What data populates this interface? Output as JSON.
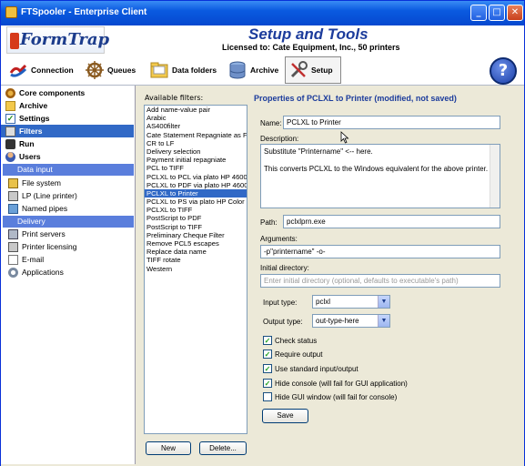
{
  "window": {
    "title": "FTSpooler - Enterprise Client"
  },
  "header": {
    "logo_text": "FormTrap",
    "title": "Setup and Tools",
    "licensed": "Licensed to: Cate Equipment, Inc., 50 printers"
  },
  "toolbar": {
    "connection": "Connection",
    "queues": "Queues",
    "data_folders": "Data folders",
    "archive": "Archive",
    "setup": "Setup",
    "help": "?"
  },
  "sidebar": {
    "core_components": "Core components",
    "archive": "Archive",
    "settings": "Settings",
    "filters": "Filters",
    "run": "Run",
    "users": "Users",
    "data_input": "Data input",
    "file_system": "File system",
    "lp": "LP (Line printer)",
    "named_pipes": "Named pipes",
    "delivery": "Delivery",
    "print_servers": "Print servers",
    "printer_licensing": "Printer licensing",
    "email": "E-mail",
    "applications": "Applications"
  },
  "filters": {
    "label": "Available filters:",
    "items": [
      "Add name-value pair",
      "Arabic",
      "AS400filter",
      "Cate Statement Repagniate as F",
      "CR to LF",
      "Delivery selection",
      "Payment initial repagniate",
      "PCL to TIFF",
      "PCLXL to PCL via plato HP 4600 F",
      "PCLXL to PDF via plato HP 4600 F",
      "PCLXL to Printer",
      "PCLXL to PS via plato HP Color La",
      "PCLXL to TIFF",
      "PostScript to PDF",
      "PostScript to TIFF",
      "Preliminary Cheque Filter",
      "Remove PCL5 escapes",
      "Replace data name",
      "TIFF rotate",
      "Western"
    ],
    "selected_index": 10,
    "new_button": "New",
    "delete_button": "Delete..."
  },
  "properties": {
    "title": "Properties of PCLXL to Printer (modified, not saved)",
    "name_label": "Name:",
    "name_value": "PCLXL to Printer",
    "description_label": "Description:",
    "description_line1": "Substitute \"Printername\" <-- here.",
    "description_line2": "This converts PCLXL to the Windows equivalent for the above printer.",
    "path_label": "Path:",
    "path_value": "pclxlprn.exe",
    "arguments_label": "Arguments:",
    "arguments_value": "-p\"printername\" -o-",
    "initdir_label": "Initial directory:",
    "initdir_placeholder": "Enter initial directory (optional, defaults to executable's path)",
    "input_type_label": "Input type:",
    "input_type_value": "pclxl",
    "output_type_label": "Output type:",
    "output_type_value": "out-type-here",
    "check_status": "Check status",
    "require_output": "Require output",
    "use_standard_io": "Use standard input/output",
    "hide_console": "Hide console (will fail for GUI application)",
    "hide_gui": "Hide GUI window (will fail for console)",
    "save_button": "Save"
  },
  "checks": {
    "check_status": true,
    "require_output": true,
    "use_standard_io": true,
    "hide_console": true,
    "hide_gui": false
  }
}
